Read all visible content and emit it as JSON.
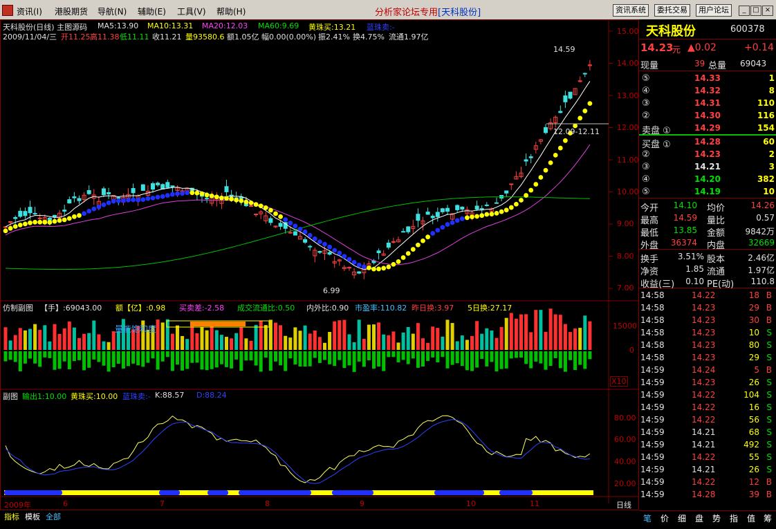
{
  "menu": {
    "items": [
      "资讯(I)",
      "港股期货",
      "导航(N)",
      "辅助(E)",
      "工具(V)",
      "帮助(H)"
    ],
    "center_title": "分析家论坛专用",
    "center_stock": "[天科股份]",
    "tool_buttons": [
      "资讯系统",
      "委托交易",
      "用户论坛"
    ],
    "window_buttons": [
      "_",
      "□",
      "×"
    ]
  },
  "main_chart": {
    "title_line": "天科股份(日线) 主图源码",
    "ma5": "MA5:13.90",
    "ma10": "MA10:13.31",
    "ma20": "MA20:12.03",
    "ma60": "MA60:9.69",
    "huangzhu": "黄珠买:13.21",
    "lanzhu": "蓝珠卖:-",
    "ohlc_line_date": "2009/11/04/三",
    "ohlc_open": "开11.25",
    "ohlc_high": "高11.38",
    "ohlc_low": "低11.11",
    "ohlc_close": "收11.21",
    "ohlc_vol": "量93580.6",
    "ohlc_amount": "额1.05亿",
    "ohlc_change": "幅0.00(0.00%)",
    "ohlc_amp": "振2.41%",
    "ohlc_turn": "换4.75%",
    "ohlc_float": "流通1.97亿",
    "high_mark": "14.59",
    "low_mark": "6.99",
    "crosshair_label": "12.09-12.11",
    "y_ticks": [
      "15.00",
      "14.00",
      "13.00",
      "12.00",
      "11.00",
      "10.00",
      "9.00",
      "8.00",
      "7.00"
    ]
  },
  "vol_chart": {
    "title": "仿制副图",
    "hand": "【手】:69043.00",
    "amount": "额【亿】:0.98",
    "buysell": "买卖差:-2.58",
    "ratio": "成交流通比:0.50",
    "inout": "内外比:0.90",
    "pe": "市盈率:110.82",
    "yday": "昨日换:3.97",
    "five": "5日换:27.17",
    "label": "量能饱和度",
    "y_ticks": [
      "15000",
      "0"
    ],
    "x10": "X10"
  },
  "kd_chart": {
    "title": "副图",
    "out": "输出1:10.00",
    "huang": "黄珠买:10.00",
    "lan": "蓝珠卖:-",
    "k": "K:88.57",
    "d": "D:88.24",
    "y_ticks": [
      "80.00",
      "60.00",
      "40.00",
      "20.00"
    ]
  },
  "time_axis": {
    "labels": [
      "2009年",
      "6",
      "7",
      "8",
      "9",
      "10",
      "11"
    ],
    "period": "日线"
  },
  "bottom_tabs": [
    "指标",
    "模板",
    "全部"
  ],
  "quote": {
    "name": "天科股份",
    "code": "600378",
    "price": "14.23",
    "unit": "元",
    "change": "▲0.02",
    "change_pct": "+0.14",
    "now_vol_label": "现量",
    "now_vol": "39",
    "total_vol_label": "总量",
    "total_vol": "69043",
    "sell": [
      {
        "label": "⑤",
        "price": "14.33",
        "vol": "1"
      },
      {
        "label": "④",
        "price": "14.32",
        "vol": "8"
      },
      {
        "label": "③",
        "price": "14.31",
        "vol": "110"
      },
      {
        "label": "②",
        "price": "14.30",
        "vol": "116"
      },
      {
        "label": "卖盘 ①",
        "price": "14.29",
        "vol": "154"
      }
    ],
    "buy": [
      {
        "label": "买盘 ①",
        "price": "14.28",
        "vol": "60"
      },
      {
        "label": "②",
        "price": "14.23",
        "vol": "2"
      },
      {
        "label": "③",
        "price": "14.21",
        "vol": "3"
      },
      {
        "label": "④",
        "price": "14.20",
        "vol": "382"
      },
      {
        "label": "⑤",
        "price": "14.19",
        "vol": "10"
      }
    ],
    "stats": [
      {
        "l1": "今开",
        "v1": "14.10",
        "l2": "均价",
        "v2": "14.26"
      },
      {
        "l1": "最高",
        "v1": "14.59",
        "l2": "量比",
        "v2": "0.57"
      },
      {
        "l1": "最低",
        "v1": "13.85",
        "l2": "金额",
        "v2": "9842万"
      },
      {
        "l1": "外盘",
        "v1": "36374",
        "l2": "内盘",
        "v2": "32669"
      }
    ],
    "fin": [
      {
        "l1": "换手",
        "v1": "3.51%",
        "l2": "股本",
        "v2": "2.46亿"
      },
      {
        "l1": "净资",
        "v1": "1.85",
        "l2": "流通",
        "v2": "1.97亿"
      },
      {
        "l1": "收益(三)",
        "v1": "0.10",
        "l2": "PE(动)",
        "v2": "110.8"
      }
    ],
    "ticks": [
      {
        "t": "14:58",
        "p": "14.22",
        "v": "18",
        "s": "B"
      },
      {
        "t": "14:58",
        "p": "14.23",
        "v": "29",
        "s": "B"
      },
      {
        "t": "14:58",
        "p": "14.23",
        "v": "30",
        "s": "B"
      },
      {
        "t": "14:58",
        "p": "14.23",
        "v": "10",
        "s": "S"
      },
      {
        "t": "14:58",
        "p": "14.23",
        "v": "80",
        "s": "S"
      },
      {
        "t": "14:58",
        "p": "14.23",
        "v": "29",
        "s": "S"
      },
      {
        "t": "14:59",
        "p": "14.24",
        "v": "5",
        "s": "B"
      },
      {
        "t": "14:59",
        "p": "14.23",
        "v": "26",
        "s": "S"
      },
      {
        "t": "14:59",
        "p": "14.22",
        "v": "104",
        "s": "S"
      },
      {
        "t": "14:59",
        "p": "14.22",
        "v": "16",
        "s": "S"
      },
      {
        "t": "14:59",
        "p": "14.22",
        "v": "56",
        "s": "S"
      },
      {
        "t": "14:59",
        "p": "14.21",
        "v": "68",
        "s": "S"
      },
      {
        "t": "14:59",
        "p": "14.21",
        "v": "492",
        "s": "S"
      },
      {
        "t": "14:59",
        "p": "14.22",
        "v": "55",
        "s": "S"
      },
      {
        "t": "14:59",
        "p": "14.21",
        "v": "26",
        "s": "S"
      },
      {
        "t": "14:59",
        "p": "14.22",
        "v": "12",
        "s": "B"
      },
      {
        "t": "14:59",
        "p": "14.28",
        "v": "39",
        "s": "B"
      }
    ],
    "tabs": [
      "笔",
      "价",
      "细",
      "盘",
      "势",
      "指",
      "值",
      "筹"
    ]
  }
}
